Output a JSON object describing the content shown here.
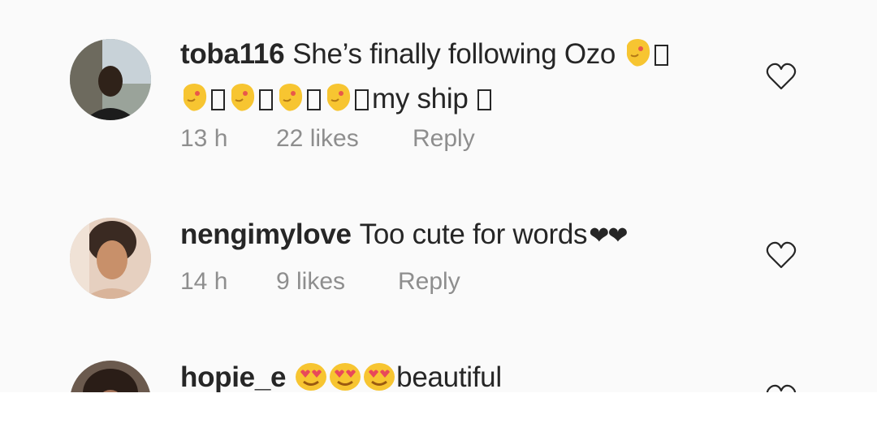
{
  "comments": [
    {
      "username": "toba116",
      "text_a": "She’s finally following Ozo",
      "text_b": "my ship",
      "time": "13 h",
      "likes": "22 likes",
      "reply": "Reply"
    },
    {
      "username": "nengimylove",
      "text": "Too cute for words",
      "hearts": "❤❤",
      "time": "14 h",
      "likes": "9 likes",
      "reply": "Reply"
    },
    {
      "username": "hopie_e",
      "text": "beautiful"
    }
  ],
  "icons": {
    "like": "heart-outline-icon",
    "kiss_emoji": "kissing-face-emoji",
    "heart_eyes_emoji": "heart-eyes-emoji"
  },
  "colors": {
    "text": "#262626",
    "meta": "#8e8e8e",
    "background": "#fafafa",
    "emoji": "#f7c531"
  }
}
